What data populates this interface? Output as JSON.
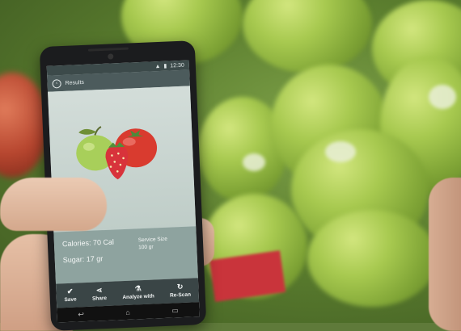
{
  "status_bar": {
    "signal_icon": "signal-icon",
    "battery_icon": "battery-icon",
    "time": "12:30"
  },
  "app_bar": {
    "back_icon": "back-icon",
    "title": "Results"
  },
  "nutrition": {
    "calories": "Calories: 70 Cal",
    "sugar": "Sugar: 17 gr",
    "service_size_label": "Service Size",
    "service_size_value": "100 gr"
  },
  "toolbar": {
    "save": "Save",
    "share": "Share",
    "analyze": "Analyze with",
    "rescan": "Re-Scan"
  },
  "colors": {
    "green_apple": "#a8cf5a",
    "tomato": "#d93b2f",
    "strawberry": "#d8333b",
    "app_bar": "#4c5b5c"
  }
}
